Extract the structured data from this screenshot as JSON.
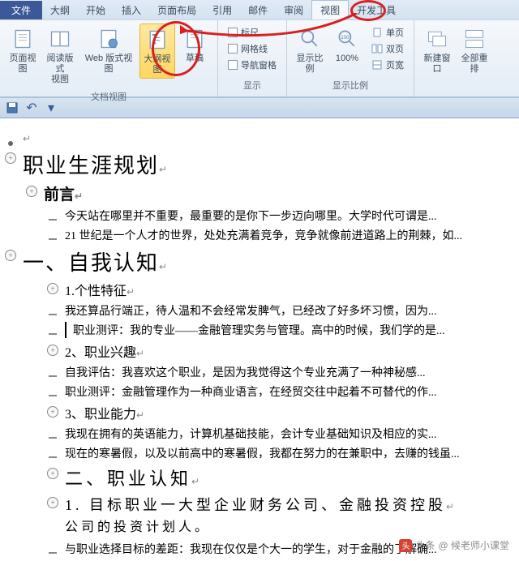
{
  "tabs": {
    "file": "文件",
    "items": [
      "大纲",
      "开始",
      "插入",
      "页面布局",
      "引用",
      "邮件",
      "审阅",
      "视图",
      "开发工具"
    ],
    "activeIndex": 7
  },
  "ribbon": {
    "group1": {
      "label": "文档视图",
      "btns": [
        {
          "label": "页面视图"
        },
        {
          "label": "阅读版式\n视图"
        },
        {
          "label": "Web 版式视图"
        },
        {
          "label": "大纲视图"
        },
        {
          "label": "草稿"
        }
      ]
    },
    "group2": {
      "label": "显示",
      "items": [
        "标尺",
        "网格线",
        "导航窗格"
      ]
    },
    "group3": {
      "label": "显示比例",
      "btns": [
        "显示比例",
        "100%"
      ],
      "side": [
        "单页",
        "双页",
        "页宽"
      ]
    },
    "group4": {
      "btns": [
        "新建窗口",
        "全部重排"
      ]
    }
  },
  "doc": {
    "rows": [
      {
        "level": 0,
        "type": "blank",
        "text": ""
      },
      {
        "level": 0,
        "type": "h1",
        "icon": "plus",
        "text": "职业生涯规划"
      },
      {
        "level": 1,
        "type": "h2",
        "icon": "plus",
        "text": "前言"
      },
      {
        "level": 2,
        "type": "body",
        "icon": "dash",
        "text": "今天站在哪里并不重要，最重要的是你下一步迈向哪里。大学时代可谓是..."
      },
      {
        "level": 2,
        "type": "body",
        "icon": "dash",
        "text": "21 世纪是一个人才的世界，处处充满着竞争，竞争就像前进道路上的荆棘，如..."
      },
      {
        "level": 0,
        "type": "h1",
        "icon": "plus",
        "text": "一、自我认知"
      },
      {
        "level": 2,
        "type": "h3",
        "icon": "plus",
        "text": "1.个性特征"
      },
      {
        "level": 2,
        "type": "body",
        "icon": "dash",
        "text": "我还算品行端正，待人温和不会经常发脾气，已经改了好多坏习惯，因为..."
      },
      {
        "level": 2,
        "type": "body",
        "icon": "dash",
        "cursor": true,
        "text": "职业测评：我的专业——金融管理实务与管理。高中的时候，我们学的是..."
      },
      {
        "level": 2,
        "type": "h3",
        "icon": "plus",
        "text": "2、职业兴趣"
      },
      {
        "level": 2,
        "type": "body",
        "icon": "dash",
        "text": "自我评估：我喜欢这个职业，是因为我觉得这个专业充满了一种神秘感..."
      },
      {
        "level": 2,
        "type": "body",
        "icon": "dash",
        "text": "职业测评：金融管理作为一种商业语言，在经贸交往中起着不可替代的作..."
      },
      {
        "level": 2,
        "type": "h3",
        "icon": "plus",
        "text": "3、职业能力"
      },
      {
        "level": 2,
        "type": "body",
        "icon": "dash",
        "text": "我现在拥有的英语能力，计算机基础技能，会计专业基础知识及相应的实..."
      },
      {
        "level": 2,
        "type": "body",
        "icon": "dash",
        "text": "现在的寒暑假，以及以前高中的寒暑假，我都在努力的在兼职中，去赚的钱虽..."
      },
      {
        "level": 2,
        "type": "h2b",
        "icon": "plus",
        "text": "二、职业认知"
      },
      {
        "level": 2,
        "type": "h3b",
        "icon": "plus",
        "text": "1. 目标职业一大型企业财务公司、金融投资控股"
      },
      {
        "level": 2,
        "type": "body2",
        "text": "公司的投资计划人。"
      },
      {
        "level": 2,
        "type": "body",
        "icon": "dash",
        "text": "与职业选择目标的差距：我现在仅仅是个大一的学生，对于金融的了解确..."
      }
    ]
  },
  "watermark": {
    "prefix": "头条",
    "text": "@ 候老师小课堂"
  }
}
